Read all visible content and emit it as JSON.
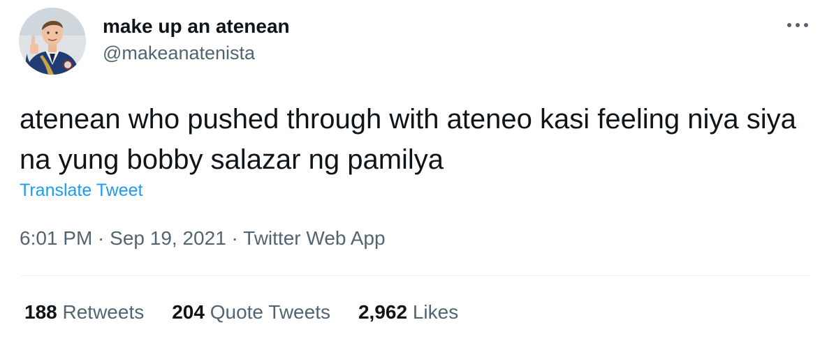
{
  "author": {
    "display_name": "make up an atenean",
    "handle": "@makeanatenista",
    "avatar_icon": "profile-photo"
  },
  "more_icon": "more-horizontal-icon",
  "tweet": {
    "text": "atenean who pushed through with ateneo kasi feeling niya siya na yung bobby salazar ng pamilya",
    "translate_label": "Translate Tweet"
  },
  "meta": {
    "time": "6:01 PM",
    "separator": " · ",
    "date": "Sep 19, 2021",
    "source": "Twitter Web App"
  },
  "stats": {
    "retweets": {
      "count": "188",
      "label": "Retweets"
    },
    "quotes": {
      "count": "204",
      "label": "Quote Tweets"
    },
    "likes": {
      "count": "2,962",
      "label": "Likes"
    }
  },
  "colors": {
    "text_primary": "#0f1419",
    "text_secondary": "#536471",
    "link": "#1d9bf0",
    "divider": "#eff3f4"
  }
}
